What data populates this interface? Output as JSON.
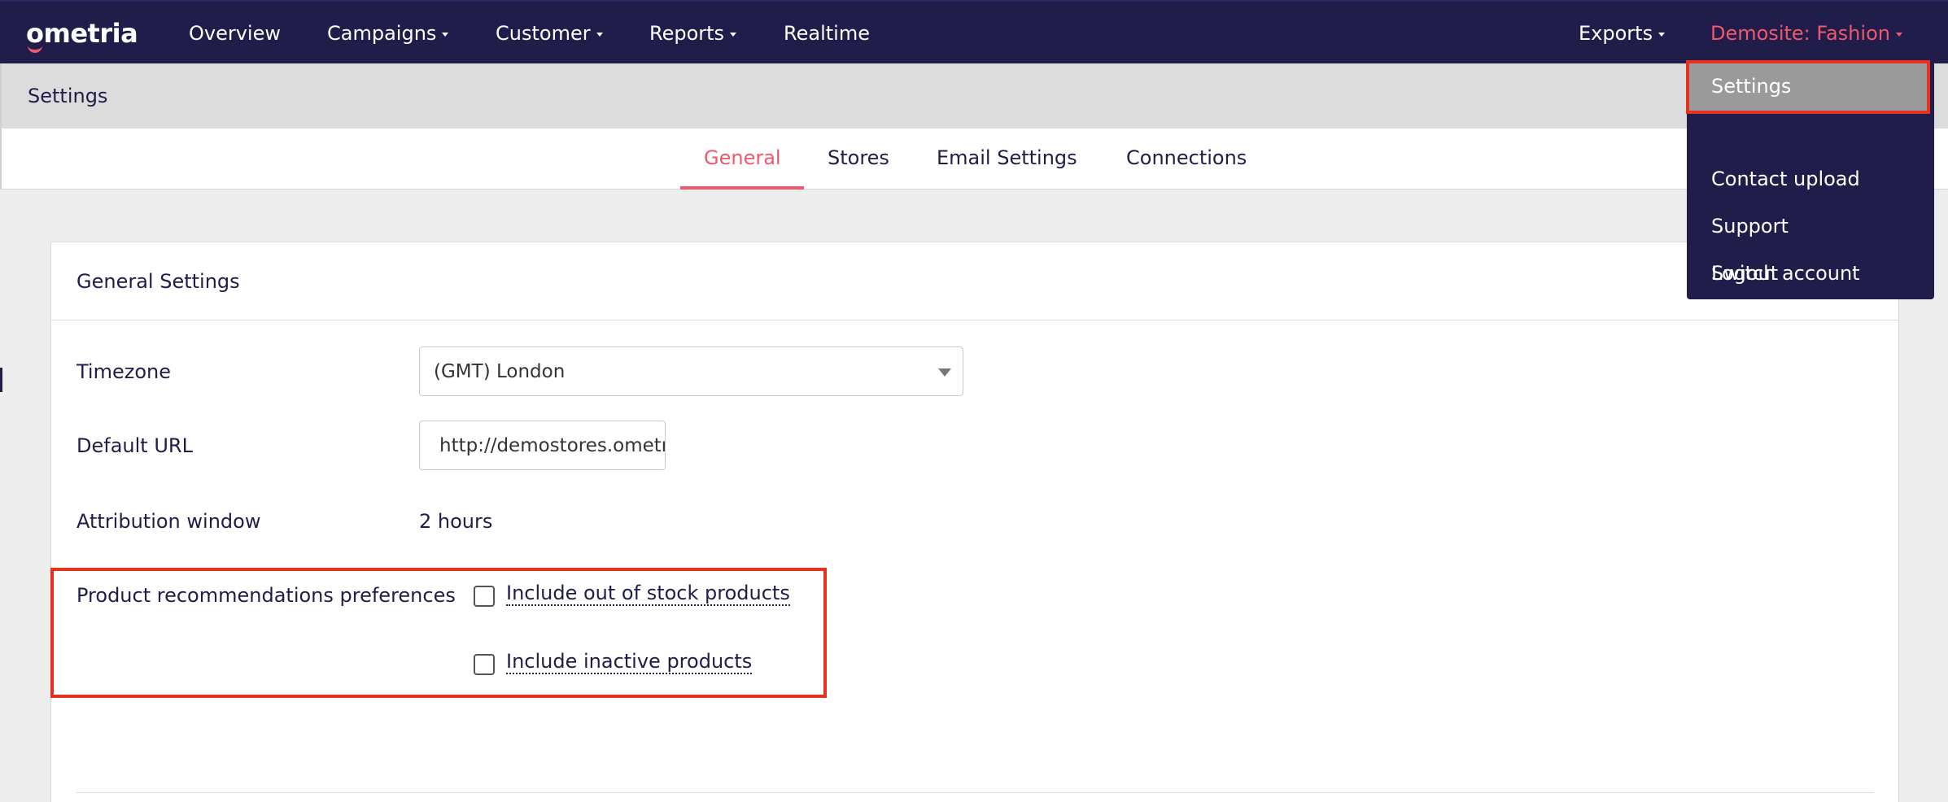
{
  "brand": {
    "name": "ometria",
    "accent_color": "#f0586b",
    "nav_color": "#201d4b"
  },
  "nav": {
    "items": [
      {
        "label": "Overview",
        "has_caret": false
      },
      {
        "label": "Campaigns",
        "has_caret": true
      },
      {
        "label": "Customer",
        "has_caret": true
      },
      {
        "label": "Reports",
        "has_caret": true
      },
      {
        "label": "Realtime",
        "has_caret": false
      }
    ],
    "exports": "Exports",
    "account": "Demosite: Fashion"
  },
  "breadcrumb": "Settings",
  "tabs": [
    {
      "label": "General",
      "active": true
    },
    {
      "label": "Stores",
      "active": false
    },
    {
      "label": "Email Settings",
      "active": false
    },
    {
      "label": "Connections",
      "active": false
    }
  ],
  "card": {
    "title": "General Settings",
    "fields": {
      "timezone": {
        "label": "Timezone",
        "value": "(GMT) London"
      },
      "default_url": {
        "label": "Default URL",
        "value": "http://demostores.ometria.com"
      },
      "attribution": {
        "label": "Attribution window",
        "value": "2 hours"
      },
      "product_recs": {
        "label": "Product recommendations preferences",
        "options": [
          {
            "label": "Include out of stock products",
            "checked": false
          },
          {
            "label": "Include inactive products",
            "checked": false
          }
        ]
      }
    }
  },
  "dropdown": {
    "items": [
      "Settings",
      "Contact upload",
      "Support",
      "Switch account",
      "Logout"
    ],
    "highlighted": "Settings"
  }
}
